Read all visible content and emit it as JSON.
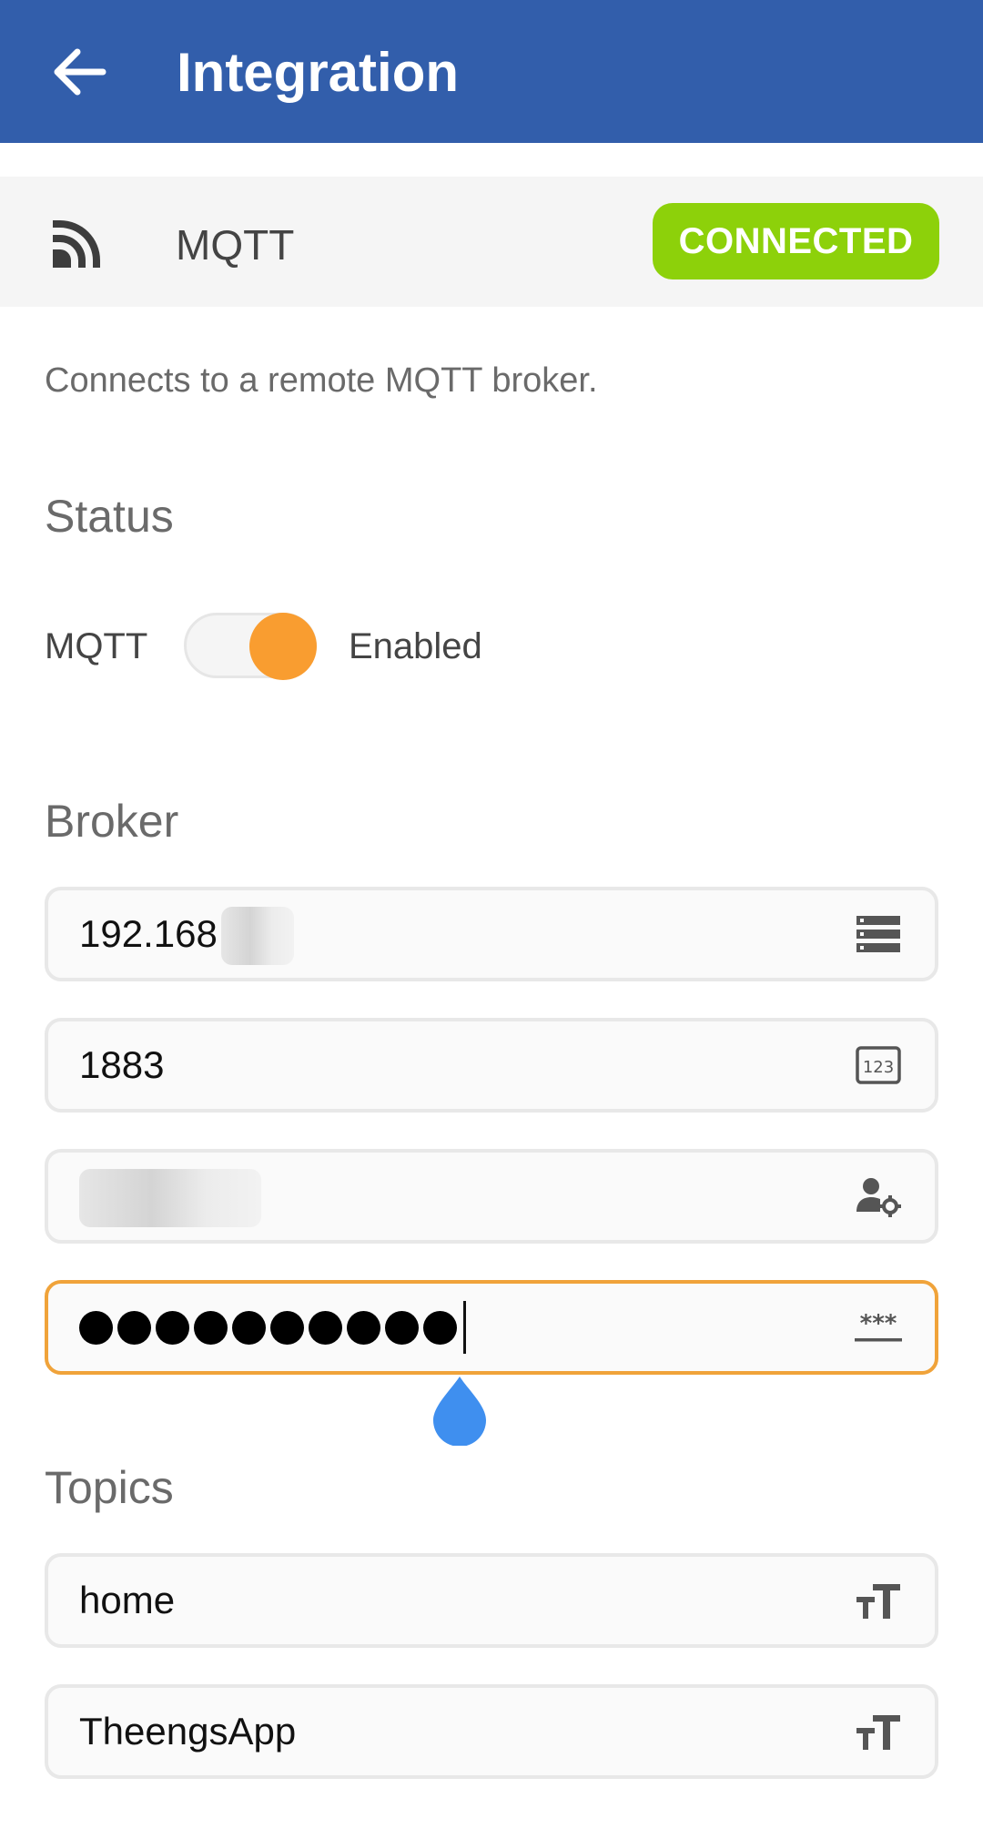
{
  "header": {
    "title": "Integration",
    "back_icon": "arrow-left-icon",
    "background": "#325eab"
  },
  "integration": {
    "name": "MQTT",
    "icon": "rss-feed-icon",
    "status_badge": "CONNECTED",
    "badge_color": "#8dd10a",
    "description": "Connects to a remote MQTT broker."
  },
  "status_section": {
    "title": "Status",
    "switch_label": "MQTT",
    "switch_state_label": "Enabled",
    "enabled": true,
    "knob_color": "#f99d30"
  },
  "broker_section": {
    "title": "Broker",
    "host": {
      "value": "192.168",
      "icon": "server-list-icon"
    },
    "port": {
      "value": "1883",
      "icon": "numeric-123-icon"
    },
    "username": {
      "value": "",
      "icon": "user-settings-icon"
    },
    "password": {
      "masked_length": 10,
      "icon": "password-asterisks-icon",
      "focused": true,
      "focus_color": "#f0a33a"
    }
  },
  "topics_section": {
    "title": "Topics",
    "topic_1": {
      "value": "home",
      "icon": "text-size-icon"
    },
    "topic_2": {
      "value": "TheengsApp",
      "icon": "text-size-icon"
    }
  },
  "text_handle_color": "#3f8fef"
}
